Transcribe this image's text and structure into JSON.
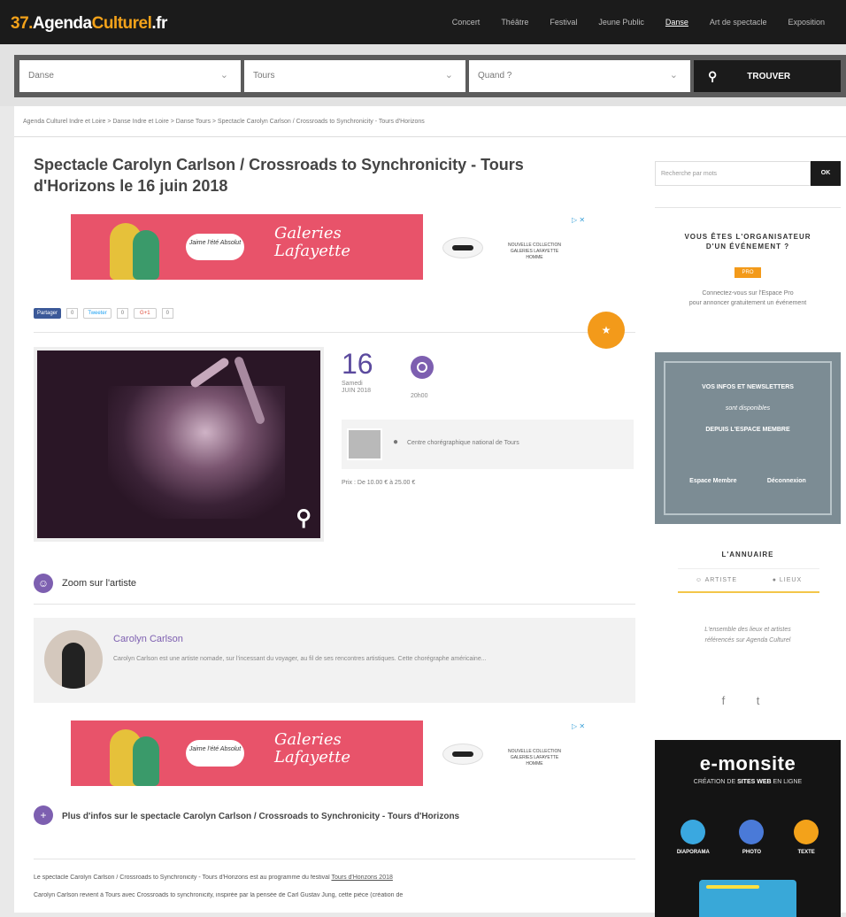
{
  "header": {
    "logo": {
      "num": "37.",
      "agenda": "Agenda",
      "culturel": "Culturel",
      "fr": ".fr"
    },
    "nav": [
      "Concert",
      "Théâtre",
      "Festival",
      "Jeune Public",
      "Danse",
      "Art de spectacle",
      "Exposition"
    ],
    "active_nav": "Danse"
  },
  "search": {
    "category": "Danse",
    "city": "Tours",
    "when": "Quand ?",
    "find_label": "TROUVER"
  },
  "breadcrumb": "Agenda Culturel Indre et Loire  >  Danse Indre et Loire  >  Danse Tours  >  Spectacle Carolyn Carlson / Crossroads to Synchronicity - Tours d'Horizons",
  "event": {
    "title": "Spectacle Carolyn Carlson / Crossroads to Synchronicity - Tours d'Horizons le 16 juin 2018",
    "day": "16",
    "weekday_month": "Samedi\nJUIN 2018",
    "time": "20h00",
    "venue": "Centre chorégraphique national de Tours",
    "price": "Prix : De 10.00 € à 25.00 €"
  },
  "ad": {
    "bubble": "Jaime l'été\nAbsolut",
    "script": "Galeries\nLafayette",
    "right_text": "NOUVELLE COLLECTION\nGALERIES LAFAYETTE\nHOMME"
  },
  "share": {
    "facebook": "Partager",
    "facebook_count": "0",
    "twitter": "Tweeter",
    "twitter_count": "0",
    "gplus": "G+1",
    "gplus_count": "0"
  },
  "artist_section": {
    "heading": "Zoom sur l'artiste",
    "name": "Carolyn Carlson",
    "description": "Carolyn Carlson est une artiste nomade, sur l'incessant du voyager, au fil de ses rencontres artistiques. Cette chorégraphe américaine..."
  },
  "more_section": {
    "heading": "Plus d'infos sur le spectacle Carolyn Carlson / Crossroads to Synchronicity - Tours d'Horizons",
    "para1_pre": "Le spectacle Carolyn Carlson / Crossroads to Synchronicity - Tours d'Horizons est au programme du festival ",
    "para1_link": "Tours d'Horizons 2018",
    "para2": "Carolyn Carlson revient à Tours avec Crossroads to synchronicity, inspirée par la pensée de Carl Gustav Jung, cette pièce (création de"
  },
  "sidebar": {
    "search_placeholder": "Recherche par mots",
    "search_ok": "OK",
    "orga_heading": "VOUS ÊTES L'ORGANISATEUR\nD'UN ÉVÉNEMENT ?",
    "orga_badge": "PRO",
    "orga_text": "Connectez-vous sur l'Espace Pro\npour annoncer gratuitement un événement",
    "member_line1": "VOS INFOS ET NEWSLETTERS",
    "member_line2": "sont disponibles",
    "member_line3": "DEPUIS L'ESPACE MEMBRE",
    "member_link1": "Espace Membre",
    "member_link2": "Déconnexion",
    "annuaire_heading": "L'ANNUAIRE",
    "annuaire_tab1": "ARTISTE",
    "annuaire_tab2": "LIEUX",
    "annuaire_text": "L'ensemble des lieux et artistes\nréférencés sur Agenda Culturel",
    "social": "f  t"
  },
  "emonsite": {
    "brand": "e-monsite",
    "tag_pre": "CRÉATION DE ",
    "tag_bold": "SITES WEB",
    "tag_post": " EN LIGNE",
    "icons": [
      {
        "label": "DIAPORAMA",
        "color": "#3aa8e0"
      },
      {
        "label": "PHOTO",
        "color": "#4a7ad8"
      },
      {
        "label": "TEXTE",
        "color": "#f3a21a"
      }
    ]
  }
}
